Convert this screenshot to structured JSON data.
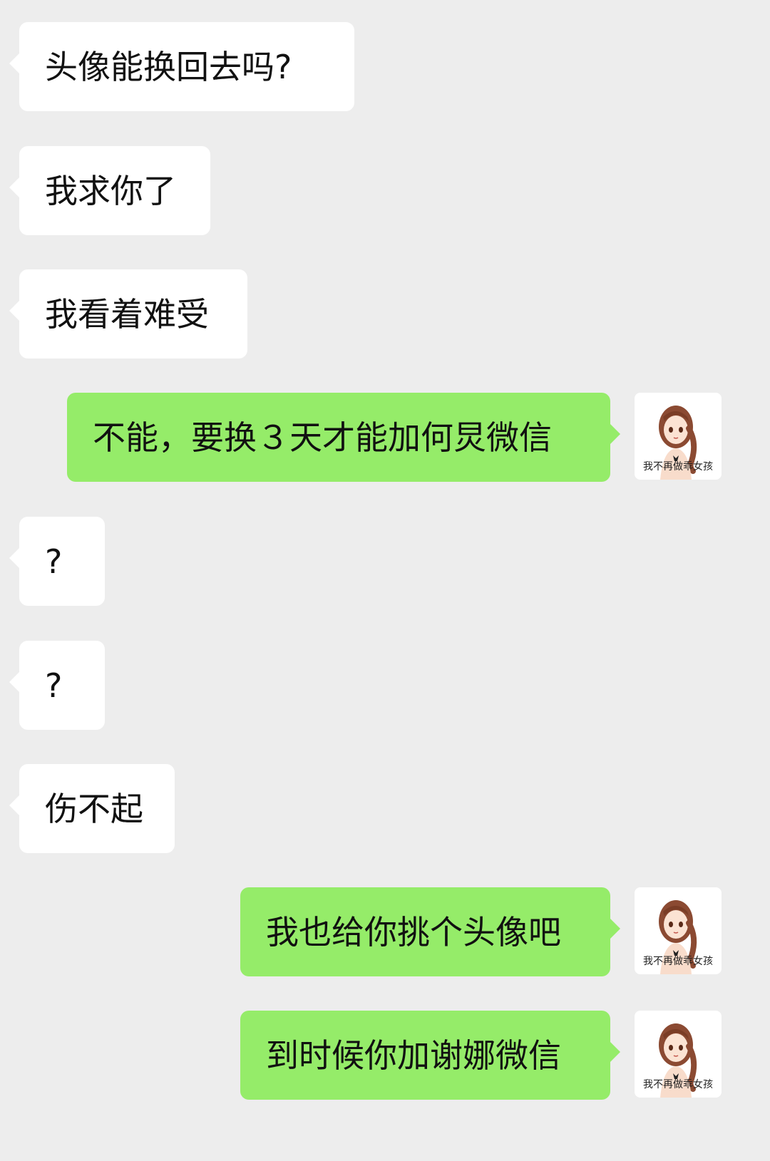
{
  "conversation": {
    "messages": [
      {
        "side": "left",
        "text": "头像能换回去吗?"
      },
      {
        "side": "left",
        "text": "我求你了"
      },
      {
        "side": "left",
        "text": "我看着难受"
      },
      {
        "side": "right",
        "text": "不能，要换３天才能加何炅微信"
      },
      {
        "side": "left",
        "text": "?"
      },
      {
        "side": "left",
        "text": "?"
      },
      {
        "side": "left",
        "text": "伤不起"
      },
      {
        "side": "right",
        "text": "我也给你挑个头像吧"
      },
      {
        "side": "right",
        "text": "到时候你加谢娜微信"
      }
    ]
  },
  "avatar": {
    "caption": "我不再做乖女孩",
    "icon": "cartoon-girl-avatar-icon"
  },
  "colors": {
    "background": "#EDEDED",
    "incoming_bubble": "#FFFFFF",
    "outgoing_bubble": "#95EC69",
    "text": "#111111"
  }
}
